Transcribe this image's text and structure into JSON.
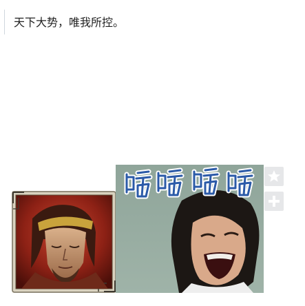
{
  "post": {
    "text": "天下大势，唯我所控。"
  },
  "images": {
    "portrait_icon": "warrior-portrait-icon",
    "meme_icon": "laughing-man-meme-icon",
    "meme_caption": "哈哈哈哈"
  },
  "actions": {
    "favorite_icon": "star-icon",
    "add_icon": "plus-icon"
  },
  "colors": {
    "text": "#222222",
    "rule": "#cfd6dd",
    "action_bg": "#e6e7e9",
    "caption_blue": "#2b5aa8"
  }
}
